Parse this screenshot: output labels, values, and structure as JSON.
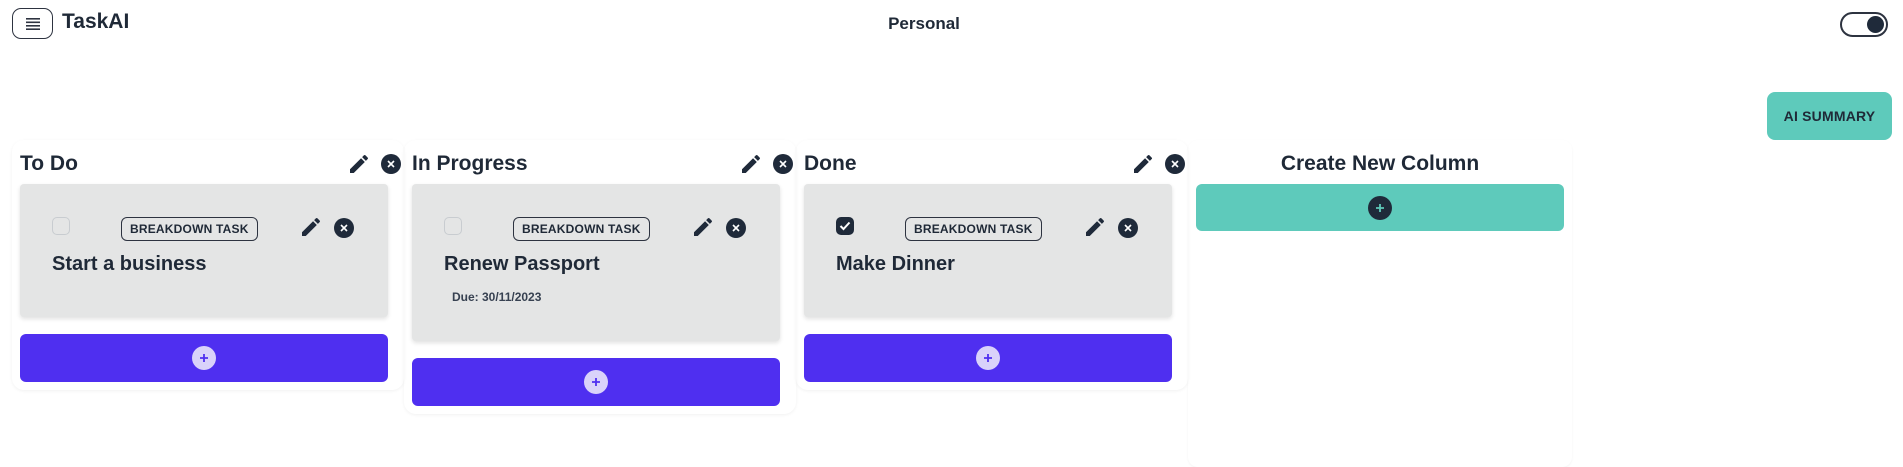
{
  "header": {
    "menu_icon": "hamburger-icon",
    "app_title": "TaskAI",
    "board_title": "Personal",
    "theme_toggle_icon": "toggle-switch-icon"
  },
  "ai_summary_label": "AI SUMMARY",
  "columns": [
    {
      "title": "To Do",
      "cards": [
        {
          "title": "Start a business",
          "badge": "BREAKDOWN TASK",
          "checked": false,
          "due": ""
        }
      ],
      "add_icon": "plus-icon"
    },
    {
      "title": "In Progress",
      "cards": [
        {
          "title": "Renew Passport",
          "badge": "BREAKDOWN TASK",
          "checked": false,
          "due": "Due: 30/11/2023"
        }
      ],
      "add_icon": "plus-icon"
    },
    {
      "title": "Done",
      "cards": [
        {
          "title": "Make Dinner",
          "badge": "BREAKDOWN TASK",
          "checked": true,
          "due": ""
        }
      ],
      "add_icon": "plus-icon"
    }
  ],
  "new_column": {
    "title": "Create New Column",
    "add_icon": "plus-icon"
  },
  "colors": {
    "accent_purple": "#4f2ff0",
    "accent_teal": "#5ecabb",
    "card_bg": "#e4e5e5",
    "dark": "#1f2a3a"
  }
}
